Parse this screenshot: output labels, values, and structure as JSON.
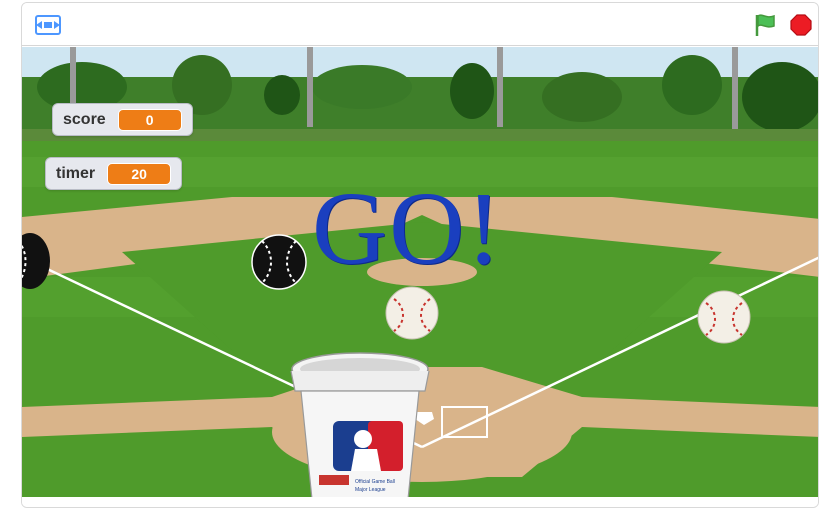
{
  "toolbar": {
    "fullscreen_icon": "fullscreen-icon",
    "green_flag_icon": "green-flag-icon",
    "stop_icon": "stop-sign-icon",
    "flag_color": "#4b8b3b",
    "stop_color": "#e8101a"
  },
  "monitors": {
    "score": {
      "label": "score",
      "value": "0"
    },
    "timer": {
      "label": "timer",
      "value": "20"
    }
  },
  "stage": {
    "message": "GO!",
    "message_color": "#1a3fbf",
    "bucket_logo_text": "Official Game Ball Bucket Major League Baseball"
  },
  "colors": {
    "grass": "#4f9b2b",
    "dirt": "#d9b48a",
    "monitor_value": "#ee7d16",
    "sky_trees": "#2f6d1f"
  }
}
